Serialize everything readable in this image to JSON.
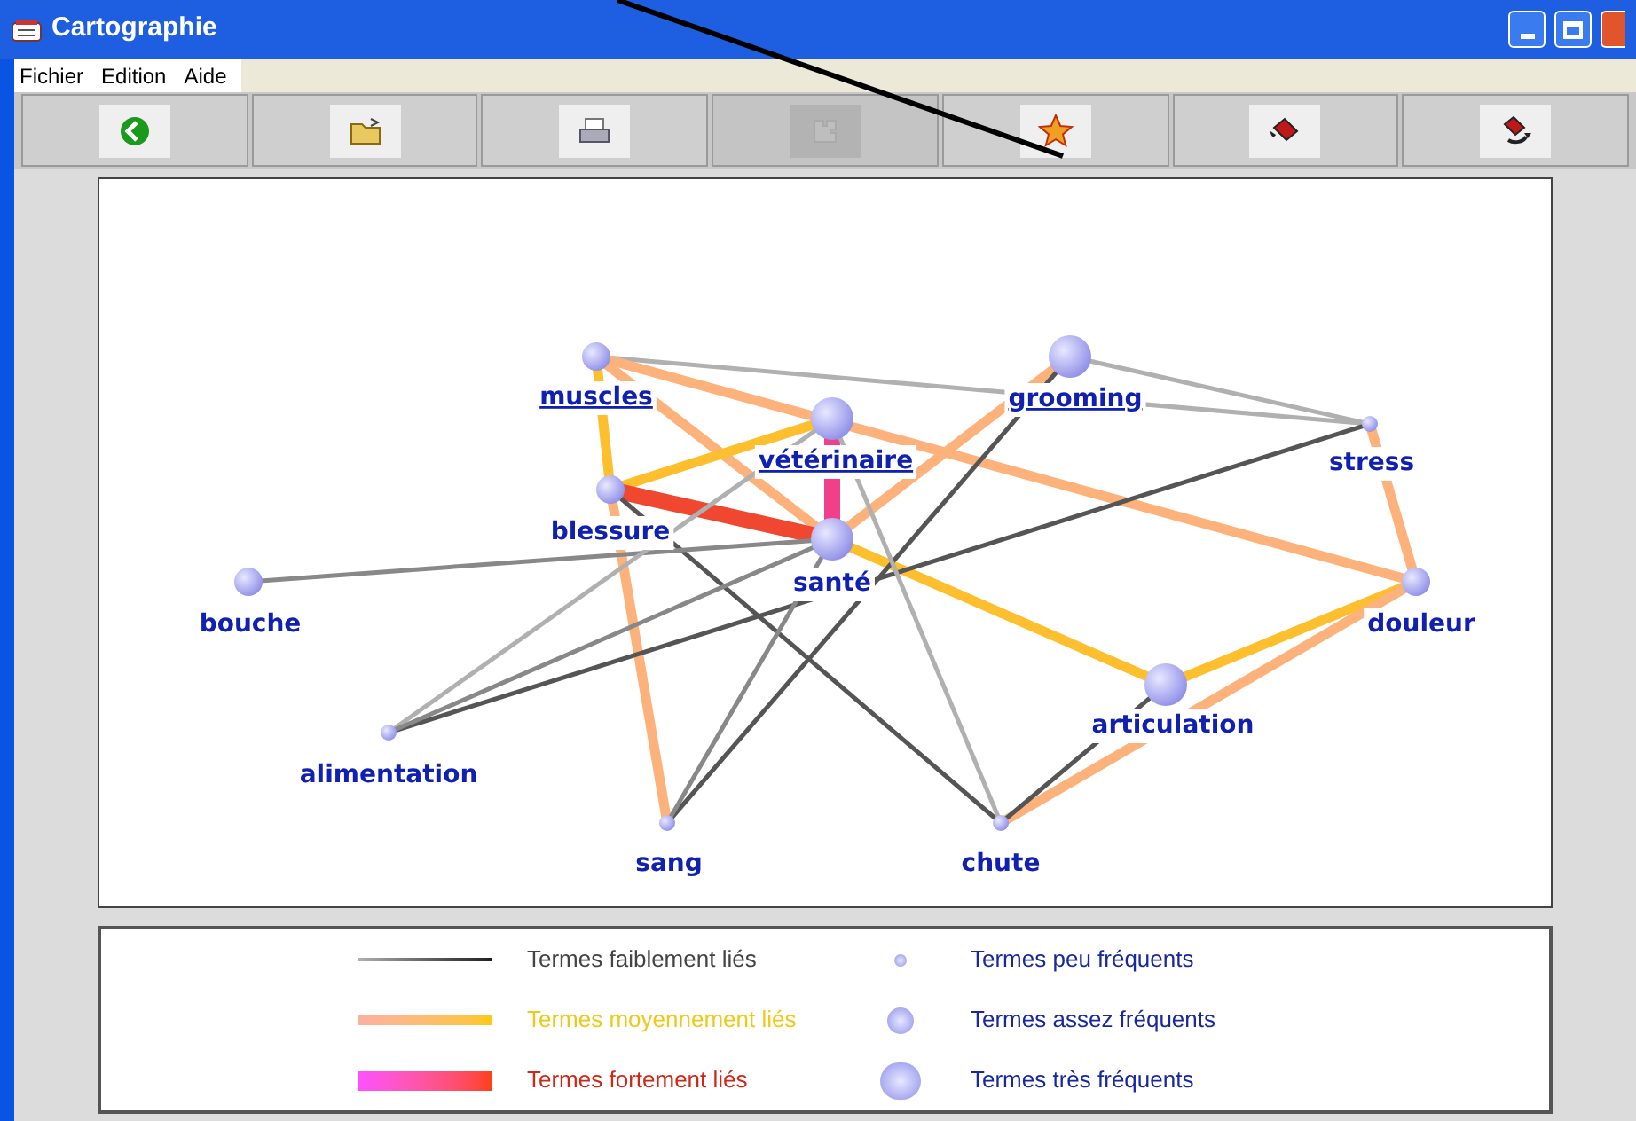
{
  "window": {
    "title": "Cartographie"
  },
  "menu": [
    "Fichier",
    "Edition",
    "Aide"
  ],
  "toolbar": [
    {
      "disabled": false
    },
    {
      "disabled": false
    },
    {
      "disabled": false
    },
    {
      "disabled": true
    },
    {
      "disabled": false
    },
    {
      "disabled": false
    },
    {
      "disabled": false
    }
  ],
  "map": {
    "nodes": [
      {
        "label": "muscles",
        "kind": "medium",
        "link": true
      },
      {
        "label": "vétérinaire",
        "kind": "large",
        "link": true
      },
      {
        "label": "blessure",
        "kind": "medium",
        "link": false
      },
      {
        "label": "santé",
        "kind": "large",
        "link": false
      },
      {
        "label": "bouche",
        "kind": "medium",
        "link": false
      },
      {
        "label": "alimentation",
        "kind": "small",
        "link": false
      },
      {
        "label": "sang",
        "kind": "small",
        "link": false
      },
      {
        "label": "chute",
        "kind": "small",
        "link": false
      },
      {
        "label": "articulation",
        "kind": "large",
        "link": false
      },
      {
        "label": "douleur",
        "kind": "medium",
        "link": false
      },
      {
        "label": "stress",
        "kind": "small",
        "link": false
      },
      {
        "label": "grooming",
        "kind": "large",
        "link": true
      }
    ]
  },
  "legend": {
    "links": [
      {
        "label": "Termes faiblement liés",
        "kind": "weak"
      },
      {
        "label": "Termes moyennement liés",
        "kind": "medium"
      },
      {
        "label": "Termes fortement liés",
        "kind": "strong"
      }
    ],
    "sizes": [
      {
        "label": "Termes peu fréquents",
        "kind": "small"
      },
      {
        "label": "Termes assez fréquents",
        "kind": "medium"
      },
      {
        "label": "Termes très fréquents",
        "kind": "large"
      }
    ]
  }
}
